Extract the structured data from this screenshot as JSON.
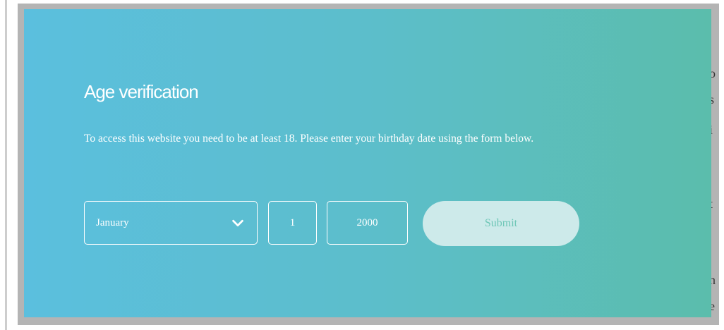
{
  "modal": {
    "title": "Age verification",
    "description": "To access this website you need to be at least 18. Please enter your birthday date using the form below."
  },
  "form": {
    "month_value": "January",
    "day_value": "1",
    "year_value": "2000",
    "submit_label": "Submit"
  },
  "background_fragments": [
    "o",
    "s",
    "i",
    "t",
    "n",
    "e"
  ],
  "colors": {
    "gradient_start": "#5bbfde",
    "gradient_end": "#5bbdac",
    "submit_background": "#cdeaea",
    "submit_text": "#6fc7b7",
    "overlay": "#b4b4b4"
  }
}
